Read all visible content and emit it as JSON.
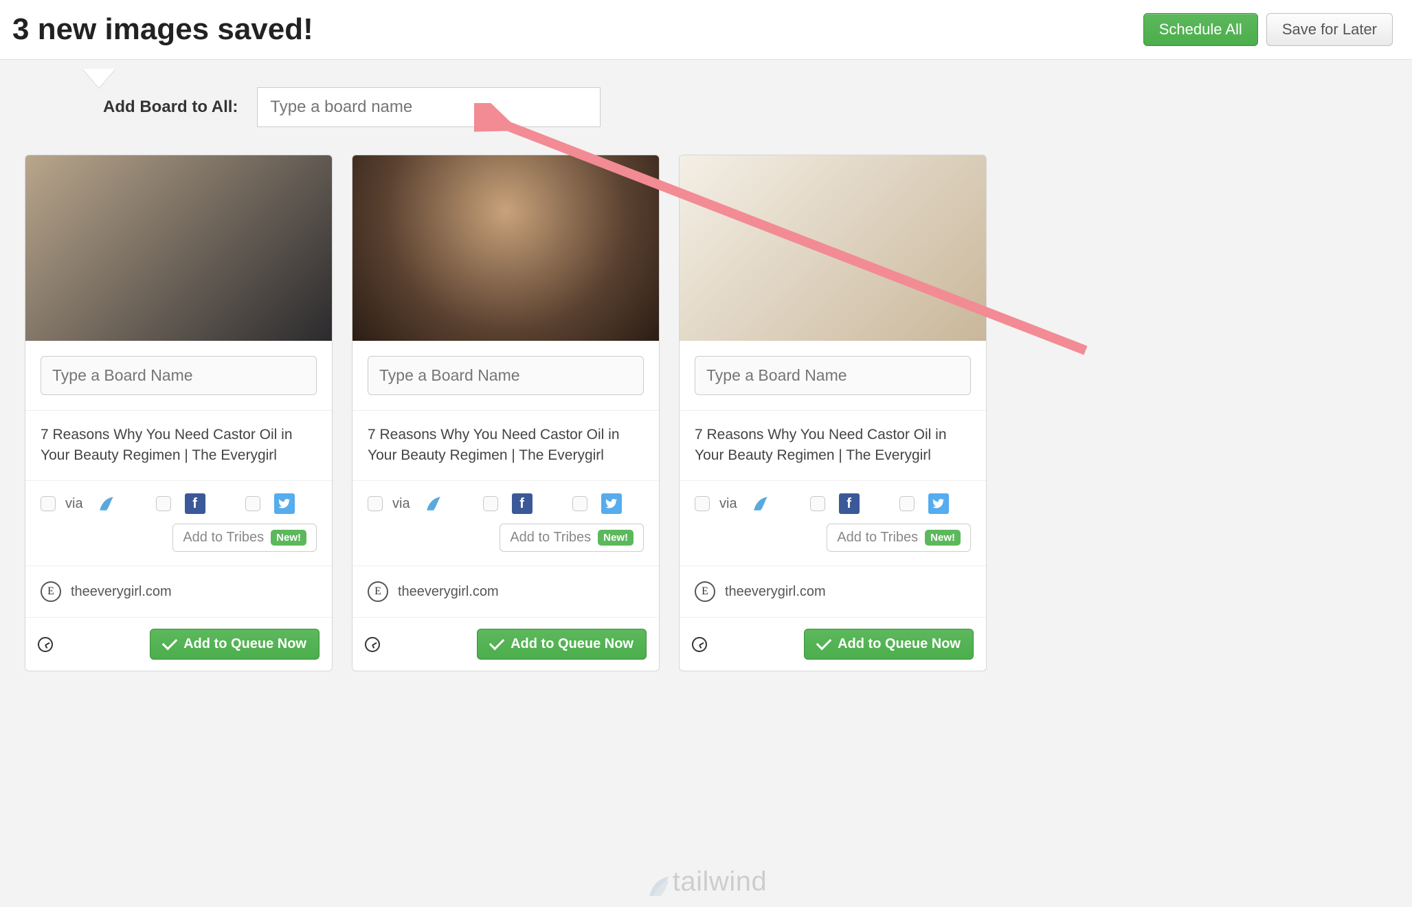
{
  "header": {
    "title": "3 new images saved!",
    "schedule_all": "Schedule All",
    "save_later": "Save for Later"
  },
  "add_board": {
    "label": "Add Board to All:",
    "placeholder": "Type a board name"
  },
  "card_common": {
    "board_placeholder": "Type a Board Name",
    "via_label": "via",
    "tribes_label": "Add to Tribes",
    "tribes_badge": "New!",
    "queue_label": "Add to Queue Now",
    "source_avatar_letter": "E"
  },
  "cards": [
    {
      "image_class": "img1",
      "description": "7 Reasons Why You Need Castor Oil in Your Beauty Regimen | The Everygirl",
      "source": "theeverygirl.com"
    },
    {
      "image_class": "img2",
      "description": "7 Reasons Why You Need Castor Oil in Your Beauty Regimen | The Everygirl",
      "source": "theeverygirl.com"
    },
    {
      "image_class": "img3",
      "description": "7 Reasons Why You Need Castor Oil in Your Beauty Regimen | The Everygirl",
      "source": "theeverygirl.com"
    }
  ],
  "watermark": {
    "text": "tailwind"
  }
}
